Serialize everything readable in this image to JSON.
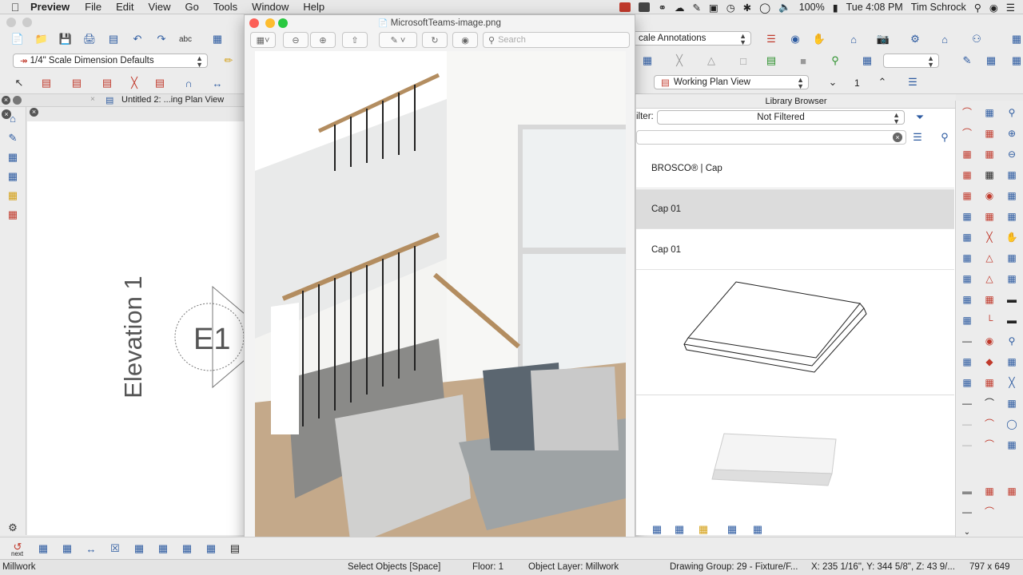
{
  "menubar": {
    "app_name": "Preview",
    "items": [
      "File",
      "Edit",
      "View",
      "Go",
      "Tools",
      "Window",
      "Help"
    ],
    "battery": "100%",
    "clock": "Tue 4:08 PM",
    "user": "Tim Schrock"
  },
  "toolbar": {
    "dimension_defaults": "1/4\" Scale Dimension Defaults",
    "annotations": "cale Annotations",
    "plan_view": "Working Plan View",
    "floor_number": "1"
  },
  "doc_tab": {
    "title": "Untitled 2:  ...ing Plan View"
  },
  "canvas": {
    "elevation_label": "Elevation 1",
    "marker_label": "E1"
  },
  "preview_window": {
    "filename": "MicrosoftTeams-image.png",
    "search_placeholder": "Search"
  },
  "library": {
    "title": "Library Browser",
    "filter_label": "ilter:",
    "filter_value": "Not Filtered",
    "rows": [
      {
        "label": "BROSCO® | Cap"
      },
      {
        "label": "Cap 01"
      },
      {
        "label": "Cap 01"
      }
    ]
  },
  "left_bottom": {
    "next_label": "next"
  },
  "status": {
    "layer": "Millwork",
    "select": "Select Objects [Space]",
    "floor": "Floor: 1",
    "object_layer": "Object Layer: Millwork",
    "drawing_group": "Drawing Group: 29 - Fixture/F...",
    "coords": "X: 235 1/16\", Y: 344 5/8\", Z: 43 9/...",
    "size": "797 x 649"
  },
  "colors": {
    "accent": "#2c5aa0",
    "red": "#c0392b"
  }
}
